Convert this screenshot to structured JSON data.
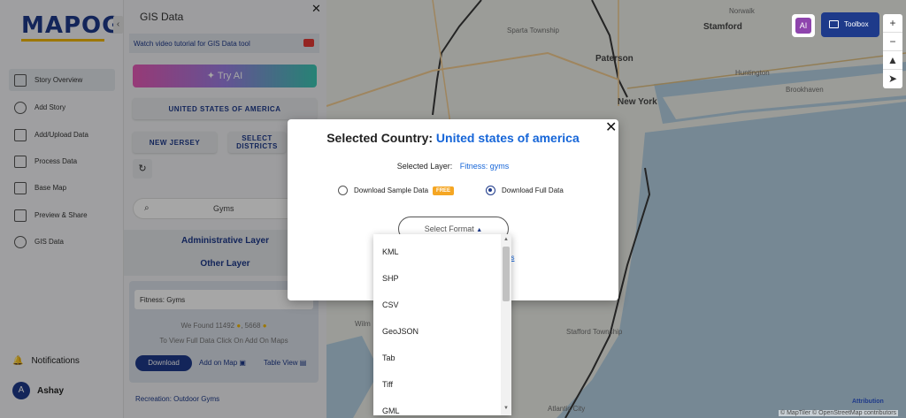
{
  "brand": {
    "logo": "MAPOG"
  },
  "nav": {
    "items": [
      {
        "label": "Story Overview"
      },
      {
        "label": "Add Story"
      },
      {
        "label": "Add/Upload Data"
      },
      {
        "label": "Process Data"
      },
      {
        "label": "Base Map"
      },
      {
        "label": "Preview & Share"
      },
      {
        "label": "GIS Data"
      }
    ],
    "notifications": "Notifications",
    "user": {
      "initial": "A",
      "name": "Ashay"
    }
  },
  "panel": {
    "title": "GIS Data",
    "tutorial": "Watch video tutorial for GIS Data tool",
    "try_ai": "Try AI",
    "country_btn": "UNITED STATES OF AMERICA",
    "state_btn": "NEW JERSEY",
    "districts_btn": "SELECT DISTRICTS",
    "search_value": "Gyms",
    "admin_layer": "Administrative Layer",
    "other_layer": "Other Layer",
    "card": {
      "name": "Fitness: Gyms",
      "found_prefix": "We Found",
      "count1": "11492",
      "count2": "5668",
      "hint": "To View Full Data Click On Add On Maps",
      "download": "Download",
      "add_on_map": "Add on Map",
      "table_view": "Table View"
    },
    "next_item": "Recreation: Outdoor Gyms"
  },
  "map": {
    "labels": {
      "sparta": "Sparta Township",
      "paterson": "Paterson",
      "newyork": "New York",
      "stamford": "Stamford",
      "norwalk": "Norwalk",
      "huntington": "Huntington",
      "brookhaven": "Brookhaven",
      "stafford": "Stafford Township",
      "atlantic": "Atlantic City",
      "wilm": "Wilm"
    },
    "attribution": "Attribution",
    "copyright": "© MapTiler © OpenStreetMap contributors"
  },
  "tools": {
    "toolbox": "Toolbox",
    "ai_badge": "AI",
    "zoom_in": "+",
    "zoom_out": "−"
  },
  "modal": {
    "title_prefix": "Selected Country:",
    "country": "United states of america",
    "layer_label": "Selected Layer:",
    "layer_value": "Fitness: gyms",
    "sample": "Download Sample Data",
    "free": "FREE",
    "full": "Download Full Data",
    "selected_option": "full",
    "select_format": "Select Format",
    "partial_link": "es"
  },
  "formats": [
    "KML",
    "SHP",
    "CSV",
    "GeoJSON",
    "Tab",
    "Tiff",
    "GML"
  ],
  "colors": {
    "primary": "#1e3a8a",
    "link": "#1565d8",
    "free_badge": "#f5a623"
  }
}
